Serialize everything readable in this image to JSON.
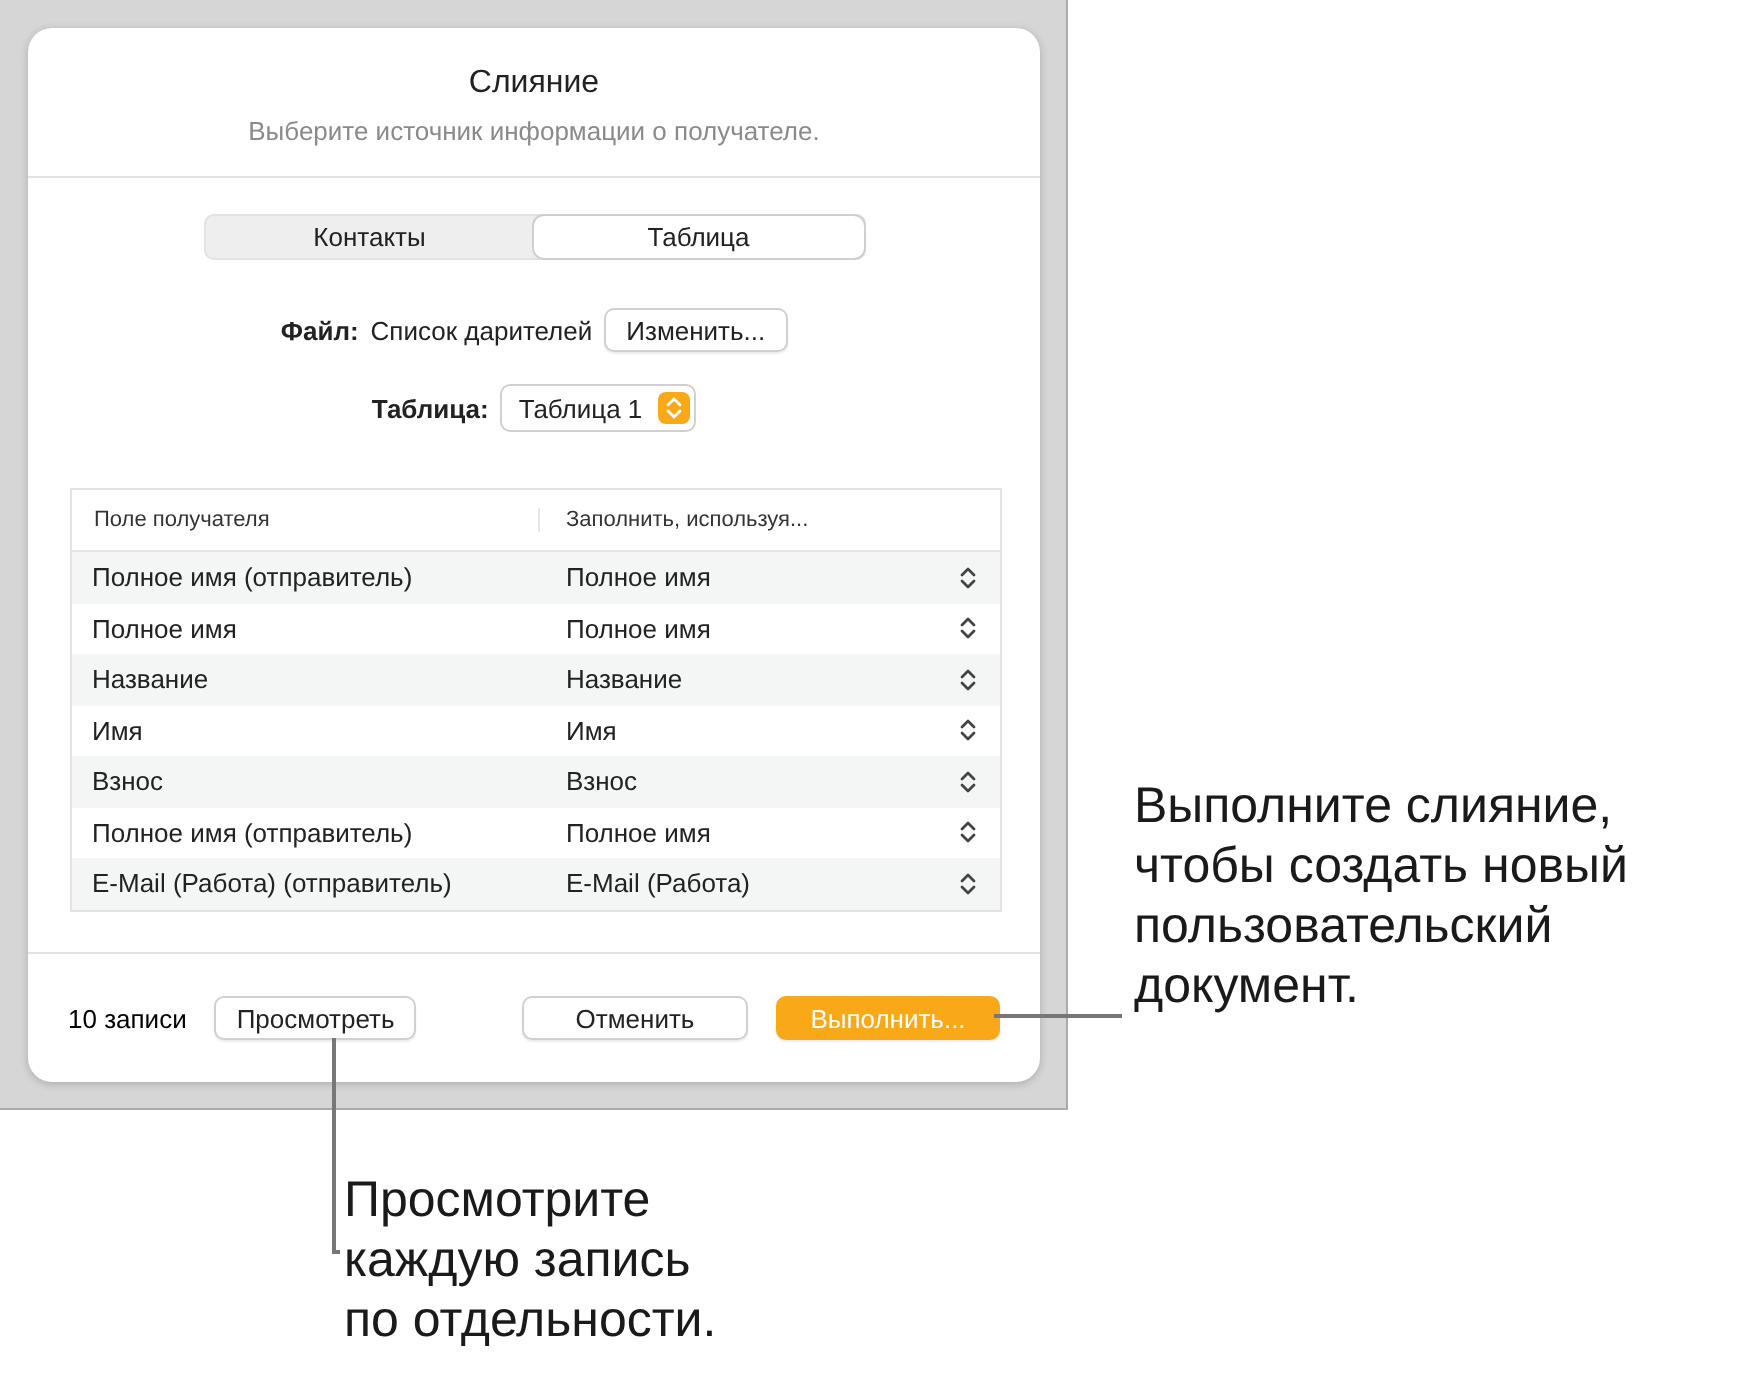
{
  "dialog": {
    "title": "Слияние",
    "subtitle": "Выберите источник информации о получателе.",
    "source_tabs": [
      {
        "label": "Контакты",
        "selected": false
      },
      {
        "label": "Таблица",
        "selected": true
      }
    ],
    "file": {
      "label": "Файл:",
      "value": "Список дарителей",
      "button": "Изменить..."
    },
    "sheet": {
      "label": "Таблица:",
      "value": "Таблица 1"
    },
    "table": {
      "columns": [
        "Поле получателя",
        "Заполнить, используя..."
      ],
      "rows": [
        {
          "field": "Полное имя (отправитель)",
          "fill": "Полное имя"
        },
        {
          "field": "Полное имя",
          "fill": "Полное имя"
        },
        {
          "field": "Название",
          "fill": "Название"
        },
        {
          "field": "Имя",
          "fill": "Имя"
        },
        {
          "field": "Взнос",
          "fill": "Взнос"
        },
        {
          "field": "Полное имя (отправитель)",
          "fill": "Полное имя"
        },
        {
          "field": "E-Mail (Работа) (отправитель)",
          "fill": "E-Mail (Работа)"
        }
      ]
    },
    "footer": {
      "count": "10 записи",
      "preview_button": "Просмотреть",
      "cancel_button": "Отменить",
      "merge_button": "Выполнить..."
    }
  },
  "callouts": [
    {
      "text": "Выполните слияние, чтобы создать новый пользовательский документ."
    },
    {
      "text": "Просмотрите каждую запись по отдельности."
    }
  ]
}
